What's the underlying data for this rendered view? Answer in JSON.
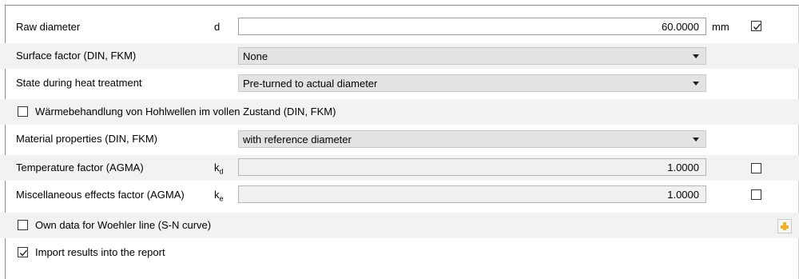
{
  "rows": {
    "raw_diameter": {
      "label": "Raw diameter",
      "symbol": "d",
      "value": "60.0000",
      "unit": "mm",
      "checked": true
    },
    "surface_factor": {
      "label": "Surface factor (DIN, FKM)",
      "selected": "None"
    },
    "state_heat_treatment": {
      "label": "State during heat treatment",
      "selected": "Pre-turned to actual diameter"
    },
    "hollow_shaft": {
      "label": "Wärmebehandlung von Hohlwellen im vollen Zustand (DIN, FKM)",
      "checked": false
    },
    "material_properties": {
      "label": "Material properties (DIN, FKM)",
      "selected": "with reference diameter"
    },
    "temperature_factor": {
      "label": "Temperature factor (AGMA)",
      "symbol_main": "k",
      "symbol_sub": "d",
      "value": "1.0000",
      "checked": false
    },
    "misc_factor": {
      "label": "Miscellaneous effects factor (AGMA)",
      "symbol_main": "k",
      "symbol_sub": "e",
      "value": "1.0000",
      "checked": false
    },
    "own_data_woehler": {
      "label": "Own data for Woehler line (S-N curve)",
      "checked": false
    },
    "import_results": {
      "label": "Import results into the report",
      "checked": true
    }
  },
  "icons": {
    "add": "plus-icon",
    "check": "checkmark-icon",
    "dropdown": "chevron-down-icon"
  },
  "colors": {
    "accent": "#f7b21b",
    "alt_row": "#f2f2f2",
    "combo_bg": "#e3e3e3",
    "readonly_bg": "#f0f0f0"
  }
}
